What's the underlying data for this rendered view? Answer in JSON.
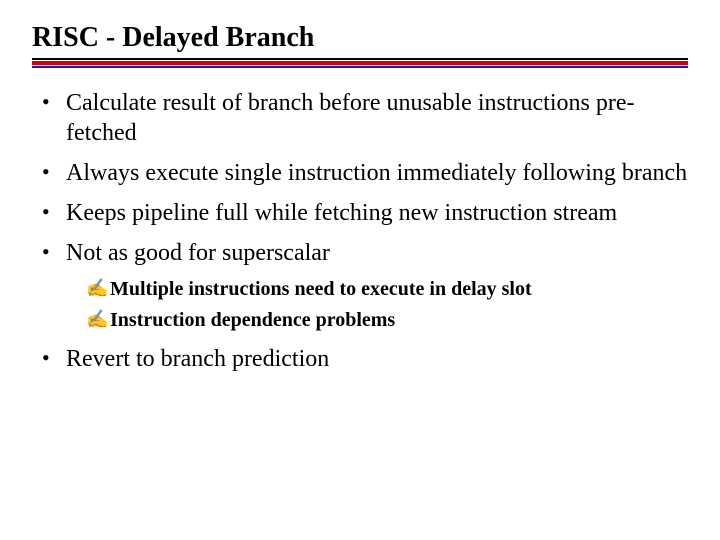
{
  "title": "RISC - Delayed Branch",
  "bullets": [
    {
      "text": "Calculate result of branch before unusable instructions pre-fetched"
    },
    {
      "text": "Always execute single instruction immediately following branch"
    },
    {
      "text": "Keeps pipeline full while fetching new instruction stream"
    },
    {
      "text": "Not as good for superscalar",
      "sub": [
        {
          "text": "Multiple instructions need to execute in delay slot"
        },
        {
          "text": "Instruction dependence problems"
        }
      ]
    },
    {
      "text": "Revert to branch prediction"
    }
  ],
  "sub_marker": "✍"
}
